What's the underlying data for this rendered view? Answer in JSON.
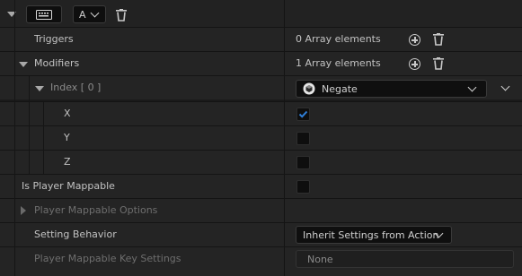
{
  "header": {
    "key_button_label": "A"
  },
  "rows": {
    "triggers": {
      "label": "Triggers",
      "value": "0 Array elements"
    },
    "modifiers": {
      "label": "Modifiers",
      "value": "1 Array elements"
    },
    "index": {
      "label": "Index [ 0 ]",
      "selected": "Negate"
    },
    "x": {
      "label": "X",
      "checked": true
    },
    "y": {
      "label": "Y",
      "checked": false
    },
    "z": {
      "label": "Z",
      "checked": false
    },
    "is_player_mappable": {
      "label": "Is Player Mappable",
      "checked": false
    },
    "player_mappable_options": {
      "label": "Player Mappable Options"
    },
    "setting_behavior": {
      "label": "Setting Behavior",
      "selected": "Inherit Settings from Action"
    },
    "player_mappable_key_settings": {
      "label": "Player Mappable Key Settings",
      "selected": "None"
    }
  },
  "colors": {
    "check_accent": "#2f7fd8",
    "row_bg": "#242424",
    "hover_row_bg": "#2c2c2c",
    "separator": "#141414"
  }
}
